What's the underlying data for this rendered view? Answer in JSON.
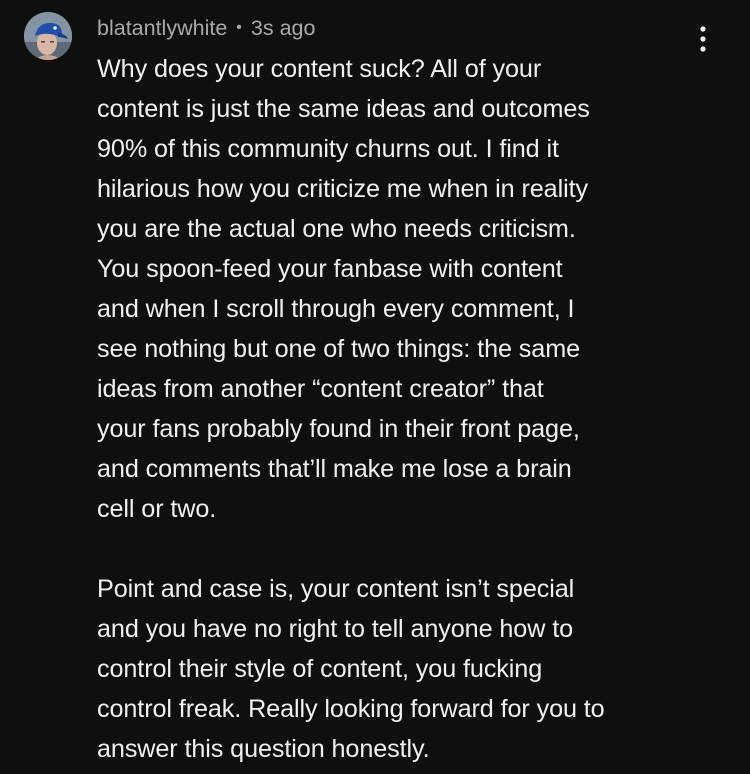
{
  "comment": {
    "author": "blatantlywhite",
    "separator": "•",
    "timestamp": "3s ago",
    "menu_icon": "vertical-ellipsis-icon",
    "avatar_icon": "user-avatar-photo",
    "paragraphs": [
      {
        "lines": [
          "Why does your content suck? All of your",
          "content is just the same ideas and outcomes",
          "90% of this community churns out. I find it",
          "hilarious how you criticize me when in reality",
          "you are the actual one who needs criticism.",
          "You spoon-feed your fanbase with content",
          "and when I scroll through every comment, I",
          "see nothing but one of two things: the same",
          "ideas from another “content creator” that",
          "your fans probably found in their front page,",
          "and comments that’ll make me lose a brain",
          "cell or two."
        ]
      },
      {
        "lines": [
          "Point and case is, your content isn’t special",
          "and you have no right to tell anyone how to",
          "control their style of content, you fucking",
          "control freak. Really looking forward for you to",
          "answer this question honestly."
        ]
      }
    ],
    "colors": {
      "background": "#0f0f0f",
      "text": "#f1f1f1",
      "meta": "#aaaaaa"
    }
  }
}
